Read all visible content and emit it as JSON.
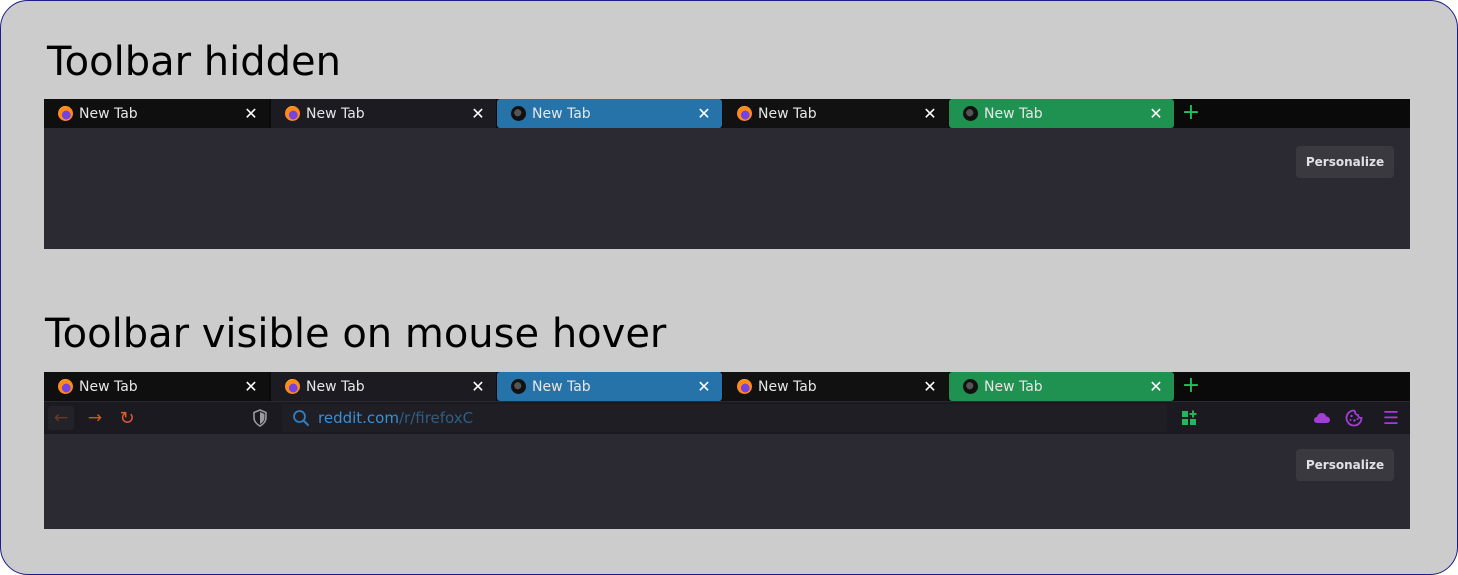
{
  "sections": [
    {
      "heading": "Toolbar hidden"
    },
    {
      "heading": "Toolbar visible on mouse hover"
    }
  ],
  "tabs": [
    {
      "label": "New Tab",
      "icon": "firefox-icon",
      "color": "#0f0f0f"
    },
    {
      "label": "New Tab",
      "icon": "firefox-icon",
      "color": "#1c1b22"
    },
    {
      "label": "New Tab",
      "icon": "private-browsing-icon",
      "color": "#2573a8"
    },
    {
      "label": "New Tab",
      "icon": "firefox-icon",
      "color": "#111111"
    },
    {
      "label": "New Tab",
      "icon": "private-browsing-icon",
      "color": "#1f9150"
    }
  ],
  "close_glyph": "✕",
  "new_tab_glyph": "+",
  "personalize_label": "Personalize",
  "toolbar": {
    "back_glyph": "←",
    "forward_glyph": "→",
    "reload_glyph": "↻",
    "menu_glyph": "☰",
    "url_domain": "reddit.com",
    "url_path": "/r/firefoxC"
  },
  "colors": {
    "frame_bg": "#cccccc",
    "frame_border": "#1c1c8a",
    "content_bg": "#2b2a33",
    "accent_green": "#1fc45c",
    "accent_orange": "#e15b2b",
    "accent_purple": "#a23dd8",
    "url_blue": "#3a8fd6"
  }
}
